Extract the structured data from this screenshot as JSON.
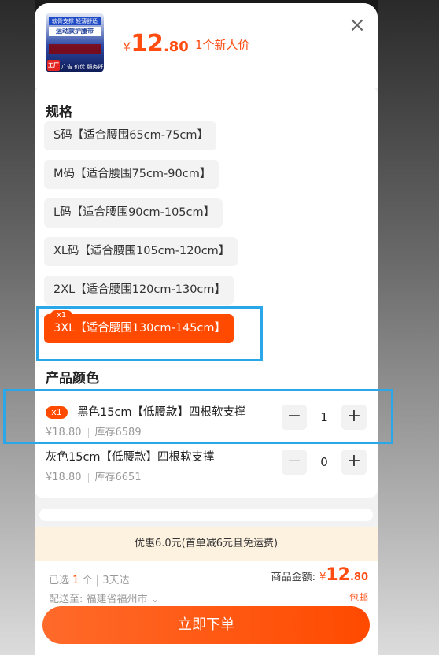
{
  "header": {
    "thumbnail": {
      "line1": "软骨支撑 轻薄舒适",
      "line2": "运动款护腰带",
      "logo": "工厂直发",
      "tag": "广告 价优 服务好"
    },
    "price": {
      "currency": "¥",
      "integer": "12",
      "decimal": ".80"
    },
    "price_note": "1个新人价",
    "close_icon": "×"
  },
  "spec": {
    "title": "规格",
    "options": [
      {
        "label": "S码【适合腰围65cm-75cm】",
        "selected": false
      },
      {
        "label": "M码【适合腰围75cm-90cm】",
        "selected": false
      },
      {
        "label": "L码【适合腰围90cm-105cm】",
        "selected": false
      },
      {
        "label": "XL码【适合腰围105cm-120cm】",
        "selected": false
      },
      {
        "label": "2XL【适合腰围120cm-130cm】",
        "selected": false
      },
      {
        "label": "3XL【适合腰围130cm-145cm】",
        "selected": true
      }
    ],
    "selected_badge": "x1"
  },
  "color": {
    "title": "产品颜色",
    "items": [
      {
        "badge": "x1",
        "name": "黑色15cm【低腰款】四根软支撑",
        "price": "¥18.80",
        "stock": "库存6589",
        "qty": "1",
        "minus_enabled": true
      },
      {
        "badge": "",
        "name": "灰色15cm【低腰款】四根软支撑",
        "price": "¥18.80",
        "stock": "库存6651",
        "qty": "0",
        "minus_enabled": false
      }
    ],
    "minus_symbol": "−",
    "plus_symbol": "+"
  },
  "promo": "优惠6.0元(首单减6元且免运费)",
  "footer": {
    "selected_prefix": "已选",
    "selected_count": "1",
    "selected_suffix": "个 | 3天达",
    "ship_label": "配送至:",
    "ship_address": "福建省福州市",
    "chevron": "⌄",
    "total_label": "商品金额:",
    "total_currency": "¥",
    "total_integer": "12",
    "total_decimal": ".80",
    "free_shipping": "包邮",
    "order_button": "立即下单"
  },
  "colors": {
    "accent": "#ff4a00",
    "highlight": "#2aa7e8",
    "promo_bg": "#fdf1df"
  }
}
